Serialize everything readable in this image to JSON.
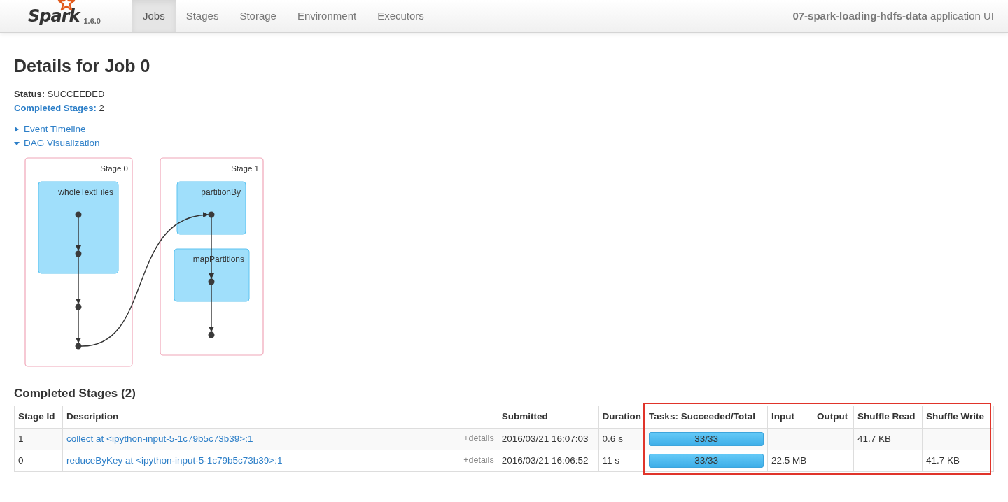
{
  "navbar": {
    "brand": "Spark",
    "version": "1.6.0",
    "tabs": [
      {
        "label": "Jobs",
        "selected": true
      },
      {
        "label": "Stages",
        "selected": false
      },
      {
        "label": "Storage",
        "selected": false
      },
      {
        "label": "Environment",
        "selected": false
      },
      {
        "label": "Executors",
        "selected": false
      }
    ],
    "app_title": "**07-spark-loading-hdfs-data** application UI"
  },
  "page_title": "Details for Job 0",
  "summary": [
    {
      "kind": "text",
      "label": "Status:",
      "value": "SUCCEEDED"
    },
    {
      "kind": "link",
      "label": "Completed Stages:",
      "value": "2"
    }
  ],
  "toggles": [
    {
      "label": "Event Timeline",
      "expanded": false
    },
    {
      "label": "DAG Visualization",
      "expanded": true
    }
  ],
  "dag": {
    "stages": [
      {
        "title": "Stage 0",
        "operations": [
          {
            "label": "wholeTextFiles"
          }
        ]
      },
      {
        "title": "Stage 1",
        "operations": [
          {
            "label": "partitionBy"
          },
          {
            "label": "mapPartitions"
          }
        ]
      }
    ]
  },
  "stages_table": {
    "title": "Completed Stages (2)",
    "columns": [
      "Stage Id",
      "Description",
      "Submitted",
      "Duration",
      "Tasks: Succeeded/Total",
      "Input",
      "Output",
      "Shuffle Read",
      "Shuffle Write"
    ],
    "rows": [
      {
        "stage_id": "1",
        "description": "collect at <ipython-input-5-1c79b5c73b39>:1",
        "details": "+details",
        "submitted": "2016/03/21 16:07:03",
        "duration": "0.6 s",
        "tasks": {
          "text": "33/33",
          "level": 1
        },
        "shuffle_read": "41.7 KB"
      },
      {
        "stage_id": "0",
        "description": "reduceByKey at <ipython-input-5-1c79b5c73b39>:1",
        "details": "+details",
        "submitted": "2016/03/21 16:06:52",
        "duration": "11 s",
        "tasks": {
          "text": "33/33",
          "level": 1
        },
        "input": "22.5 MB",
        "shuffle_write": "41.7 KB"
      }
    ]
  }
}
